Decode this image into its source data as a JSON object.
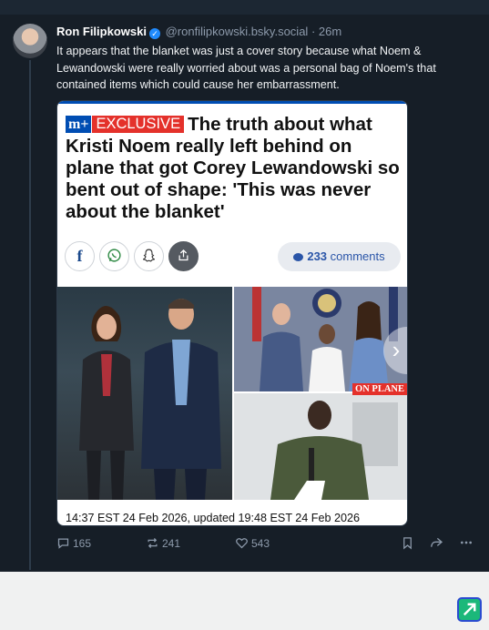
{
  "post": {
    "author": "Ron Filipkowski",
    "handle": "@ronfilipkowski.bsky.social",
    "separator": "·",
    "time": "26m",
    "text": "It appears that the blanket was just a cover story because what Noem & Lewandowski were really worried about was a personal bag of Noem's that contained items which could cause her embarrassment."
  },
  "card": {
    "brand": "m+",
    "badge": "EXCLUSIVE",
    "headline": "The truth about what Kristi Noem really left behind on plane that got Corey Lewandowski so bent out of shape: 'This was never about the blanket'",
    "share_icons": [
      "facebook-icon",
      "whatsapp-icon",
      "snapchat-icon",
      "share-icon"
    ],
    "facebook_glyph": "f",
    "comments_count": "233",
    "comments_label": "comments",
    "photo_overlay_label": "ON PLANE",
    "arrow_glyph": "›",
    "date_line": "14:37 EST 24 Feb 2026, updated 19:48 EST 24 Feb 2026"
  },
  "actions": {
    "replies": "165",
    "reposts": "241",
    "likes": "543"
  },
  "colors": {
    "background": "#161e27",
    "accent": "#208bfe",
    "exclusive_red": "#e4312b",
    "brand_blue": "#004db3"
  }
}
